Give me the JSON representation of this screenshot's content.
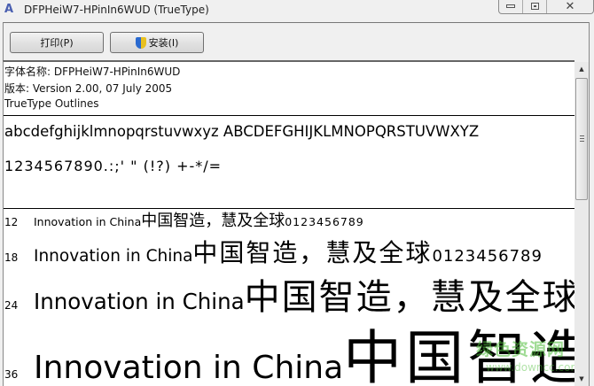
{
  "window": {
    "title": "DFPHeiW7-HPinIn6WUD (TrueType)",
    "controls": [
      "minimize",
      "maximize",
      "close"
    ]
  },
  "toolbar": {
    "print_label": "打印(P)",
    "install_label": "安装(I)"
  },
  "info": {
    "font_name": "字体名称: DFPHeiW7-HPinIn6WUD",
    "version": "版本: Version 2.00, 07 July 2005",
    "outlines": "TrueType Outlines"
  },
  "charset": {
    "letters": "abcdefghijklmnopqrstuvwxyz ABCDEFGHIJKLMNOPQRSTUVWXYZ",
    "digits": "1234567890.:;' \" (!?) +-*/="
  },
  "samples": [
    {
      "size": "12",
      "text": "Innovation in China ",
      "cjk": "中国智造，慧及全球 ",
      "digits": "0123456789"
    },
    {
      "size": "18",
      "text": "Innovation in China ",
      "cjk": "中国智造，慧及全球 ",
      "digits": "0123456789"
    },
    {
      "size": "24",
      "text": "Innovation in China ",
      "cjk": "中国智造，慧及全球 ",
      "digits": ""
    },
    {
      "size": "36",
      "text": "Innovation in China ",
      "cjk": "中国智造",
      "digits": ""
    }
  ],
  "watermark": {
    "name": "绿色资源网",
    "url": "www.downcc.com"
  }
}
